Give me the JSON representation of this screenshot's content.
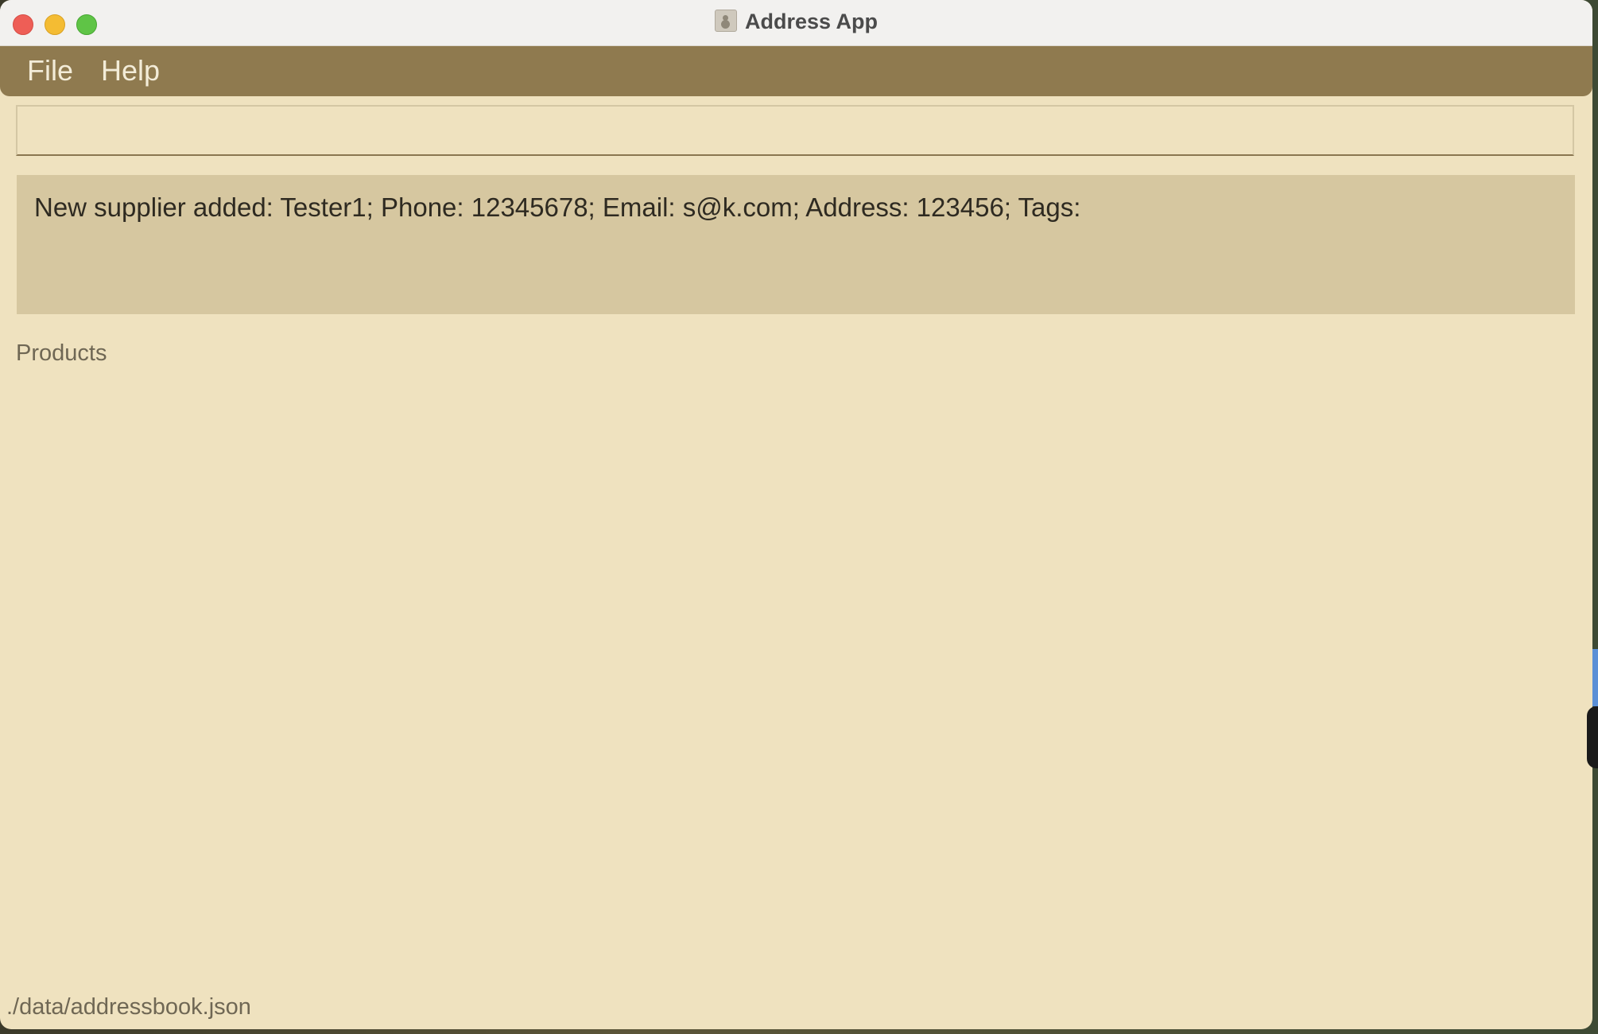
{
  "window": {
    "title": "Address App",
    "app_icon": "address-book-icon"
  },
  "controls": {
    "close": "close-icon",
    "minimize": "minimize-icon",
    "maximize": "maximize-icon"
  },
  "menubar": {
    "file_label": "File",
    "help_label": "Help"
  },
  "command": {
    "value": "",
    "placeholder": ""
  },
  "result": {
    "message": "New supplier added: Tester1; Phone: 12345678; Email: s@k.com; Address: 123456; Tags:"
  },
  "products": {
    "label": "Products",
    "items": []
  },
  "status": {
    "file_path": "./data/addressbook.json"
  },
  "colors": {
    "menubar_bg": "#8f7a4f",
    "window_bg": "#efe2bf",
    "result_bg": "#d6c7a0"
  }
}
